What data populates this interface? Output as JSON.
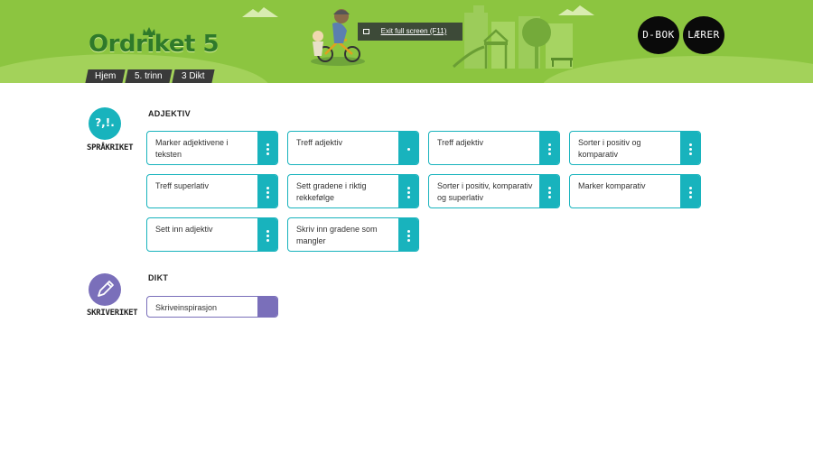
{
  "header": {
    "logo_text": "Ordriket 5",
    "breadcrumb": [
      "Hjem",
      "5. trinn",
      "3 Dikt"
    ],
    "exit_fullscreen_label": "Exit full screen (F11)",
    "dbok_label": "D-BOK",
    "laerer_label": "LÆRER"
  },
  "colors": {
    "header_green": "#8cc540",
    "logo_green": "#2f7a2a",
    "teal": "#18b3bd",
    "purple": "#7a6fba"
  },
  "sections": [
    {
      "icon": "punctuation-icon",
      "icon_text": "?,!.",
      "caption": "SPRÅKRIKET",
      "title": "ADJEKTIV",
      "items": [
        "Marker adjektivene i teksten",
        "Treff adjektiv",
        "Treff adjektiv",
        "Sorter i positiv og komparativ",
        "Treff superlativ",
        "Sett gradene i riktig rekkefølge",
        "Sorter i positiv, komparativ og superlativ",
        "Marker komparativ",
        "Sett inn adjektiv",
        "Skriv inn gradene som mangler"
      ]
    },
    {
      "icon": "pencil-icon",
      "caption": "SKRIVERIKET",
      "title": "DIKT",
      "items": [
        "Skriveinspirasjon"
      ]
    }
  ]
}
